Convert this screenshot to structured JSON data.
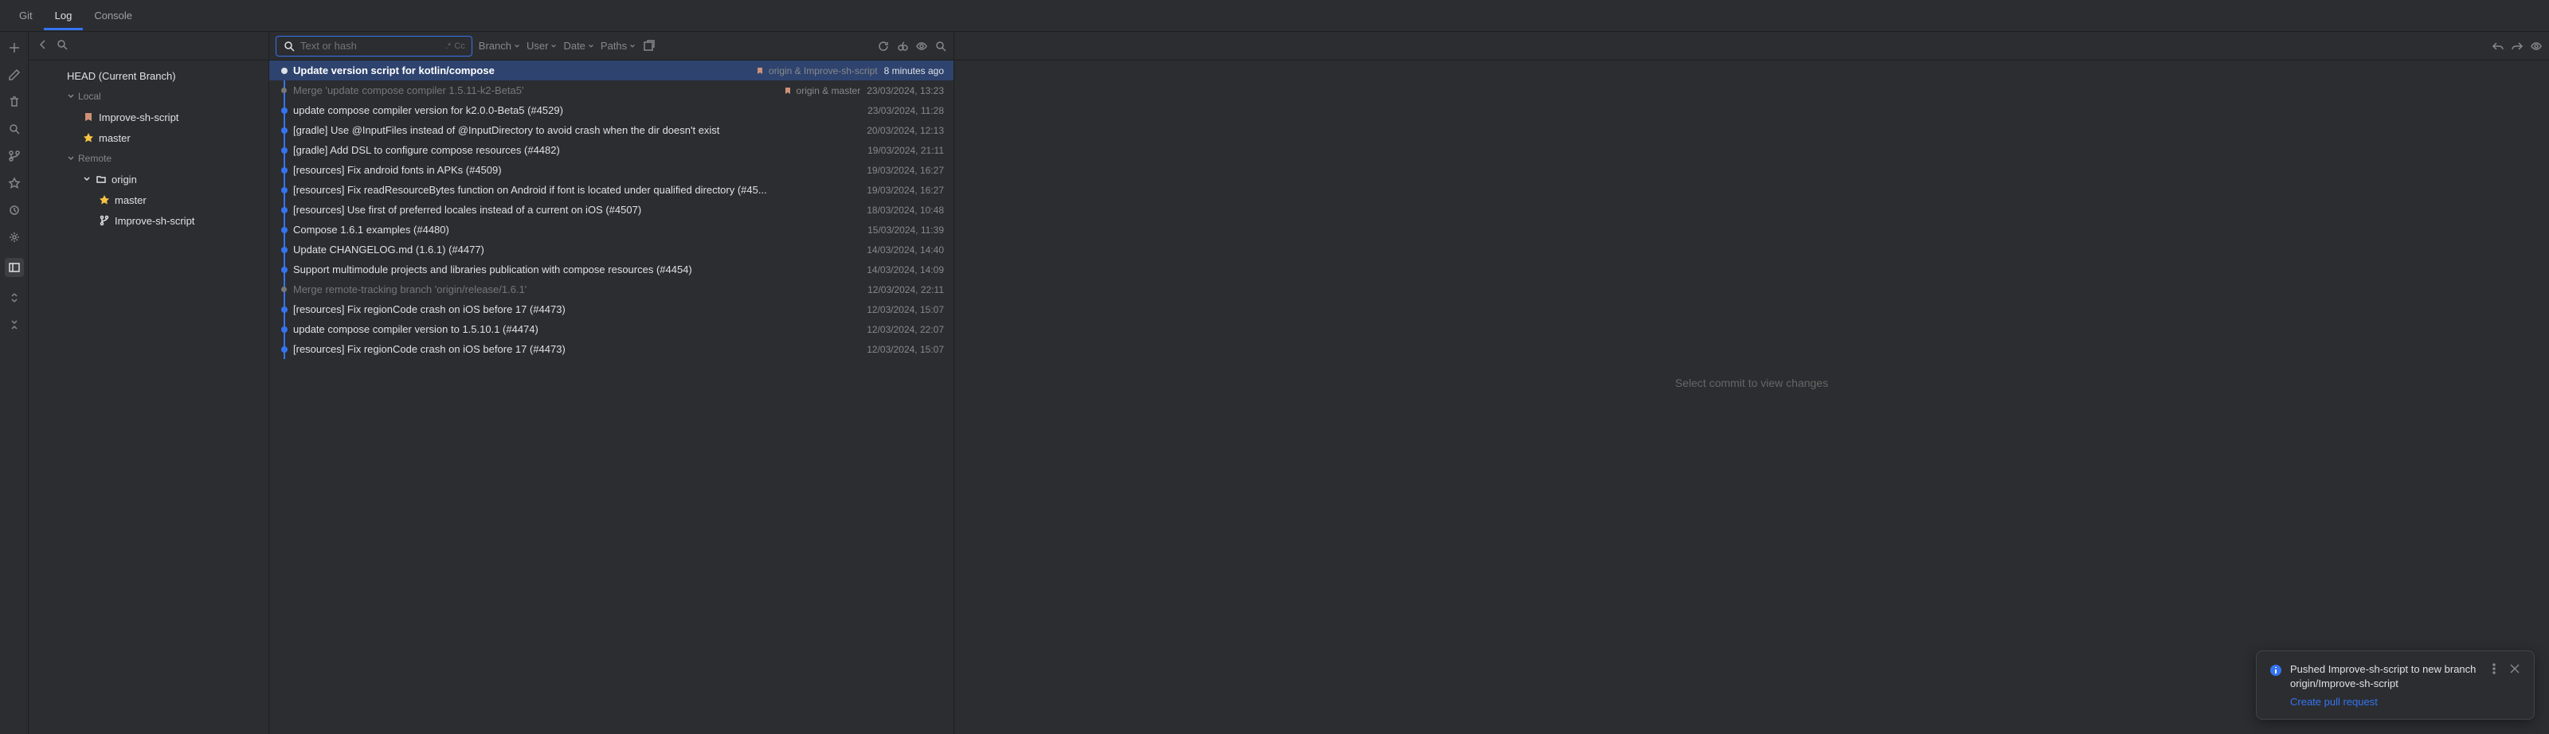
{
  "tabs": [
    {
      "label": "Git",
      "active": false
    },
    {
      "label": "Log",
      "active": true
    },
    {
      "label": "Console",
      "active": false
    }
  ],
  "branches": {
    "head": "HEAD (Current Branch)",
    "local_label": "Local",
    "remote_label": "Remote",
    "origin_label": "origin",
    "local": [
      {
        "name": "Improve-sh-script",
        "icon": "branch"
      },
      {
        "name": "master",
        "icon": "star"
      }
    ],
    "remote": [
      {
        "name": "master",
        "icon": "star"
      },
      {
        "name": "Improve-sh-script",
        "icon": "branch"
      }
    ]
  },
  "filters": {
    "search_placeholder": "Text or hash",
    "regex_hint": ".*",
    "cc_hint": "Cc",
    "branch": "Branch",
    "user": "User",
    "date": "Date",
    "paths": "Paths"
  },
  "detail_placeholder": "Select commit to view changes",
  "commits": [
    {
      "msg": "Update version script for kotlin/compose",
      "date": "8 minutes ago",
      "tags": "origin & Improve-sh-script",
      "selected": true
    },
    {
      "msg": "Merge 'update compose compiler 1.5.11-k2-Beta5'",
      "date": "23/03/2024, 13:23",
      "tags": "origin & master",
      "merge": true
    },
    {
      "msg": "update compose compiler version for k2.0.0-Beta5 (#4529)",
      "date": "23/03/2024, 11:28"
    },
    {
      "msg": "[gradle] Use @InputFiles instead of @InputDirectory to avoid crash when the dir doesn't exist",
      "date": "20/03/2024, 12:13"
    },
    {
      "msg": "[gradle] Add DSL to configure compose resources (#4482)",
      "date": "19/03/2024, 21:11"
    },
    {
      "msg": "[resources] Fix android fonts in APKs (#4509)",
      "date": "19/03/2024, 16:27"
    },
    {
      "msg": "[resources] Fix readResourceBytes function on Android if font is located under qualified directory (#45...",
      "date": "19/03/2024, 16:27"
    },
    {
      "msg": "[resources] Use first of preferred locales instead of a current on iOS (#4507)",
      "date": "18/03/2024, 10:48"
    },
    {
      "msg": "Compose 1.6.1 examples (#4480)",
      "date": "15/03/2024, 11:39"
    },
    {
      "msg": "Update CHANGELOG.md (1.6.1) (#4477)",
      "date": "14/03/2024, 14:40"
    },
    {
      "msg": "Support multimodule projects and libraries publication with compose resources (#4454)",
      "date": "14/03/2024, 14:09"
    },
    {
      "msg": "Merge remote-tracking branch 'origin/release/1.6.1'",
      "date": "12/03/2024, 22:11",
      "merge": true
    },
    {
      "msg": "[resources] Fix regionCode crash on iOS before 17 (#4473)",
      "date": "12/03/2024, 15:07"
    },
    {
      "msg": "update compose compiler version to 1.5.10.1 (#4474)",
      "date": "12/03/2024, 22:07"
    },
    {
      "msg": "[resources] Fix regionCode crash on iOS before 17 (#4473)",
      "date": "12/03/2024, 15:07"
    }
  ],
  "toast": {
    "title": "Pushed Improve-sh-script to new branch origin/Improve-sh-script",
    "link": "Create pull request"
  }
}
